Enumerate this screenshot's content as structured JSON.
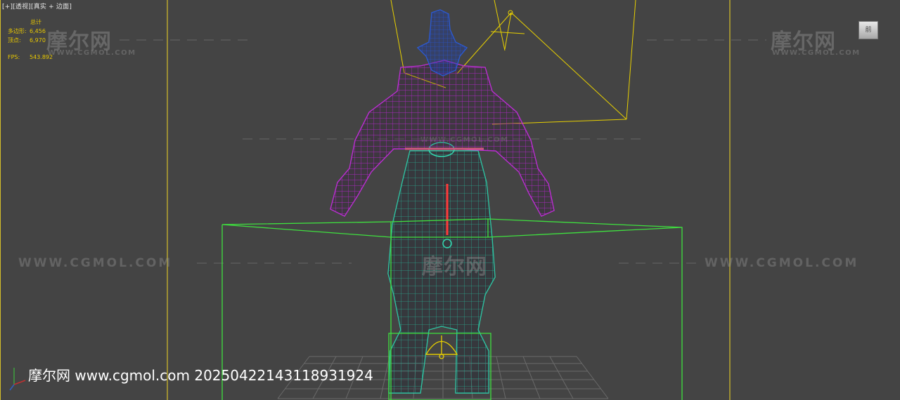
{
  "viewport": {
    "label_parts": [
      "[+]",
      "[透视]",
      "[真实 + 边面]"
    ]
  },
  "stats": {
    "header": "总计",
    "polygons_label": "多边形:",
    "polygons_value": "6,456",
    "vertices_label": "顶点:",
    "vertices_value": "6,970",
    "fps_label": "FPS:",
    "fps_value": "543.892"
  },
  "watermarks": {
    "logo_text": "摩尔网",
    "site_small": "WWW.CGMOL.COM",
    "site_url": "WWW.CGMOL.COM"
  },
  "viewcube": {
    "face_label": "前"
  },
  "footer": {
    "text": "摩尔网 www.cgmol.com 20250422143118931924"
  },
  "colors": {
    "background": "#444444",
    "safe_frame": "#d6c02a",
    "head_mesh": "#2f5fd8",
    "torso_mesh": "#c832e0",
    "lower_mesh": "#33d8b0",
    "bounding_box": "#3fe03f",
    "light_gizmo": "#e8d000"
  },
  "icons": [
    "light-gizmo-icon",
    "axis-tripod-icon",
    "viewcube-icon"
  ]
}
